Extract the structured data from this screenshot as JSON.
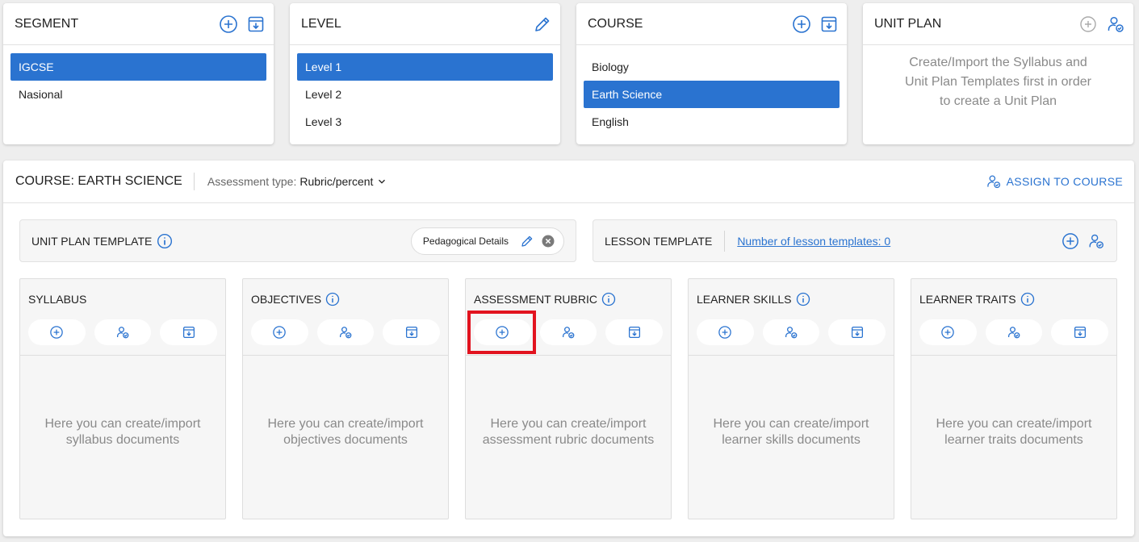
{
  "segment": {
    "title": "SEGMENT",
    "items": [
      "IGCSE",
      "Nasional"
    ],
    "selected": "IGCSE"
  },
  "level": {
    "title": "LEVEL",
    "items": [
      "Level 1",
      "Level 2",
      "Level 3"
    ],
    "selected": "Level 1"
  },
  "course": {
    "title": "COURSE",
    "items": [
      "Biology",
      "Earth Science",
      "English"
    ],
    "selected": "Earth Science"
  },
  "unit_plan": {
    "title": "UNIT PLAN",
    "hint": "Create/Import the Syllabus and Unit Plan Templates first in order to create a Unit Plan"
  },
  "main": {
    "course_label": "COURSE: EARTH SCIENCE",
    "assessment_label": "Assessment type:",
    "assessment_value": "Rubric/percent",
    "assign_label": "ASSIGN TO COURSE"
  },
  "unit_plan_template": {
    "title": "UNIT PLAN TEMPLATE",
    "chip": "Pedagogical Details"
  },
  "lesson_template": {
    "title": "LESSON TEMPLATE",
    "link": "Number of lesson templates: 0"
  },
  "columns": [
    {
      "title": "SYLLABUS",
      "info": false,
      "message": "Here you can create/import syllabus documents"
    },
    {
      "title": "OBJECTIVES",
      "info": true,
      "message": "Here you can create/import objectives documents"
    },
    {
      "title": "ASSESSMENT RUBRIC",
      "info": true,
      "message": "Here you can create/import assessment rubric documents"
    },
    {
      "title": "LEARNER SKILLS",
      "info": true,
      "message": "Here you can create/import learner skills documents"
    },
    {
      "title": "LEARNER TRAITS",
      "info": true,
      "message": "Here you can create/import learner traits documents"
    }
  ],
  "colors": {
    "accent": "#2a73d0",
    "highlight": "#e2131f",
    "muted_text": "#8a8a8a"
  }
}
